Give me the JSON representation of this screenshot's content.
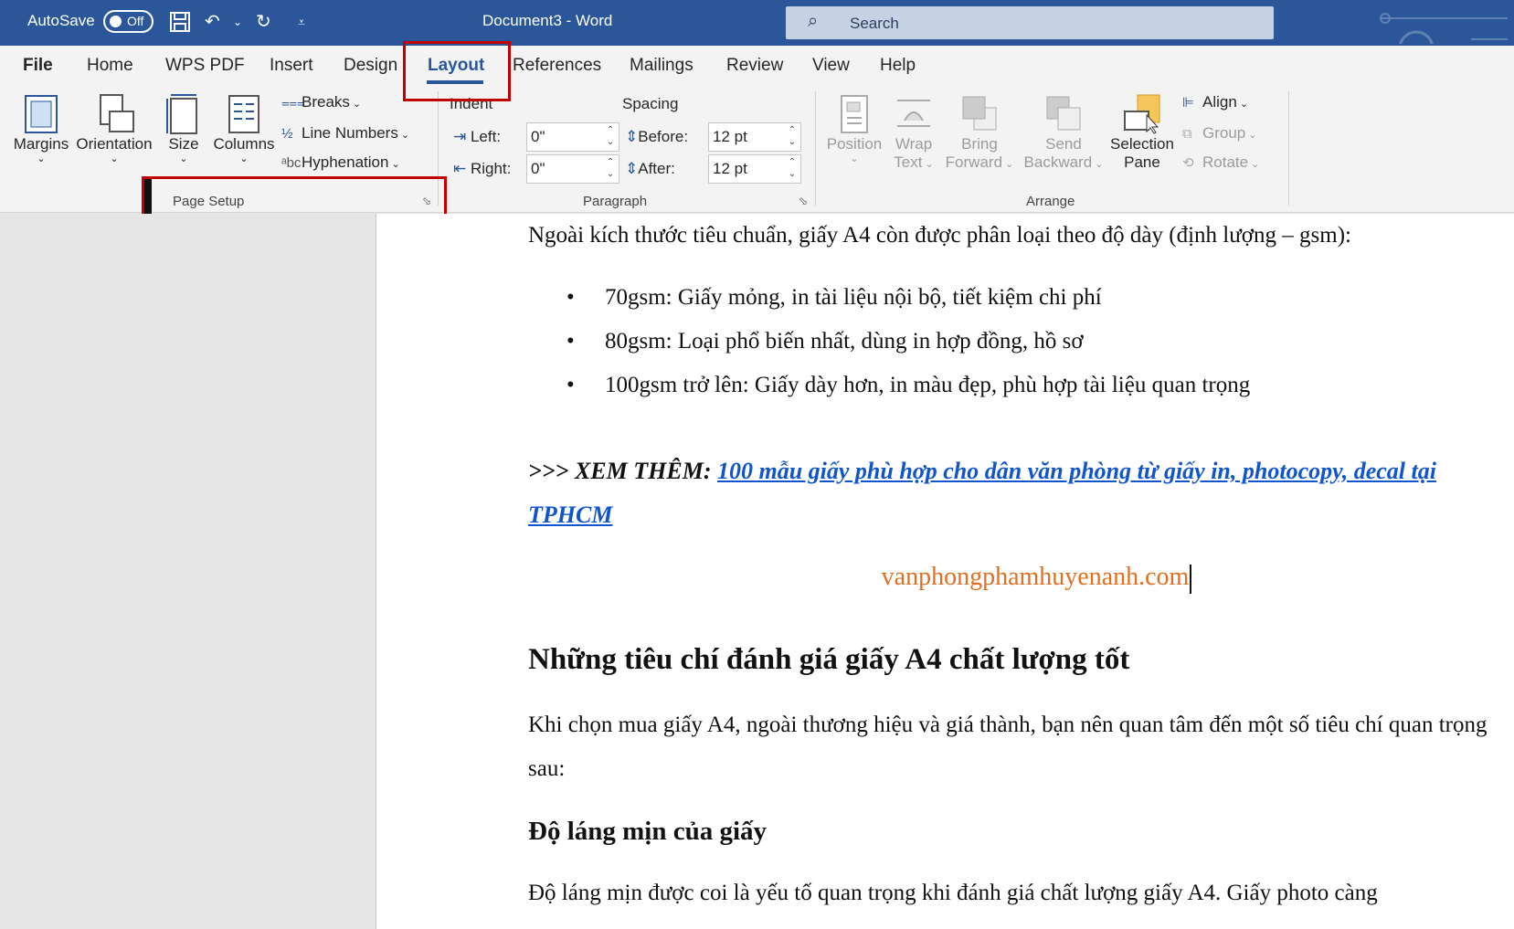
{
  "titlebar": {
    "autosave_label": "AutoSave",
    "autosave_state": "Off",
    "document_title": "Document3  -  Word",
    "search_placeholder": "Search"
  },
  "tabs": [
    "File",
    "Home",
    "WPS PDF",
    "Insert",
    "Design",
    "Layout",
    "References",
    "Mailings",
    "Review",
    "View",
    "Help"
  ],
  "active_tab": "Layout",
  "ribbon": {
    "page_setup": {
      "label": "Page Setup",
      "margins": "Margins",
      "orientation": "Orientation",
      "size": "Size",
      "columns": "Columns",
      "breaks": "Breaks",
      "line_numbers": "Line Numbers",
      "hyphenation": "Hyphenation"
    },
    "paragraph": {
      "label": "Paragraph",
      "indent_label": "Indent",
      "spacing_label": "Spacing",
      "left_label": "Left:",
      "left_value": "0\"",
      "right_label": "Right:",
      "right_value": "0\"",
      "before_label": "Before:",
      "before_value": "12 pt",
      "after_label": "After:",
      "after_value": "12 pt"
    },
    "arrange": {
      "label": "Arrange",
      "position": "Position",
      "wrap_text_1": "Wrap",
      "wrap_text_2": "Text",
      "bring_forward_1": "Bring",
      "bring_forward_2": "Forward",
      "send_backward_1": "Send",
      "send_backward_2": "Backward",
      "selection_pane_1": "Selection",
      "selection_pane_2": "Pane",
      "align": "Align",
      "group": "Group",
      "rotate": "Rotate"
    }
  },
  "document": {
    "intro": "Ngoài kích thước tiêu chuẩn, giấy A4 còn được phân loại theo độ dày (định lượng – gsm):",
    "bullets": [
      "70gsm: Giấy mỏng, in tài liệu nội bộ, tiết kiệm chi phí",
      "80gsm: Loại phổ biến nhất, dùng in hợp đồng, hồ sơ",
      "100gsm trở lên: Giấy dày hơn, in màu đẹp, phù hợp tài liệu quan trọng"
    ],
    "see_more_prefix": ">>> XEM THÊM: ",
    "see_more_link": "100 mẫu giấy phù hợp cho dân văn phòng từ giấy in, photocopy, decal tại TPHCM",
    "site": "vanphongphamhuyenanh.com",
    "heading2": "Những tiêu chí đánh giá giấy A4 chất lượng tốt",
    "para2": "Khi chọn mua giấy A4, ngoài thương hiệu và giá thành, bạn nên quan tâm đến một số tiêu chí quan trọng sau:",
    "heading3": "Độ láng mịn của giấy",
    "para3": "Độ láng mịn được coi là yếu tố quan trọng khi đánh giá chất lượng giấy A4. Giấy photo càng"
  },
  "colors": {
    "titlebar": "#2b579a",
    "highlight_box": "#c00000",
    "link": "#1155cc",
    "site_text": "#e06f1f"
  }
}
